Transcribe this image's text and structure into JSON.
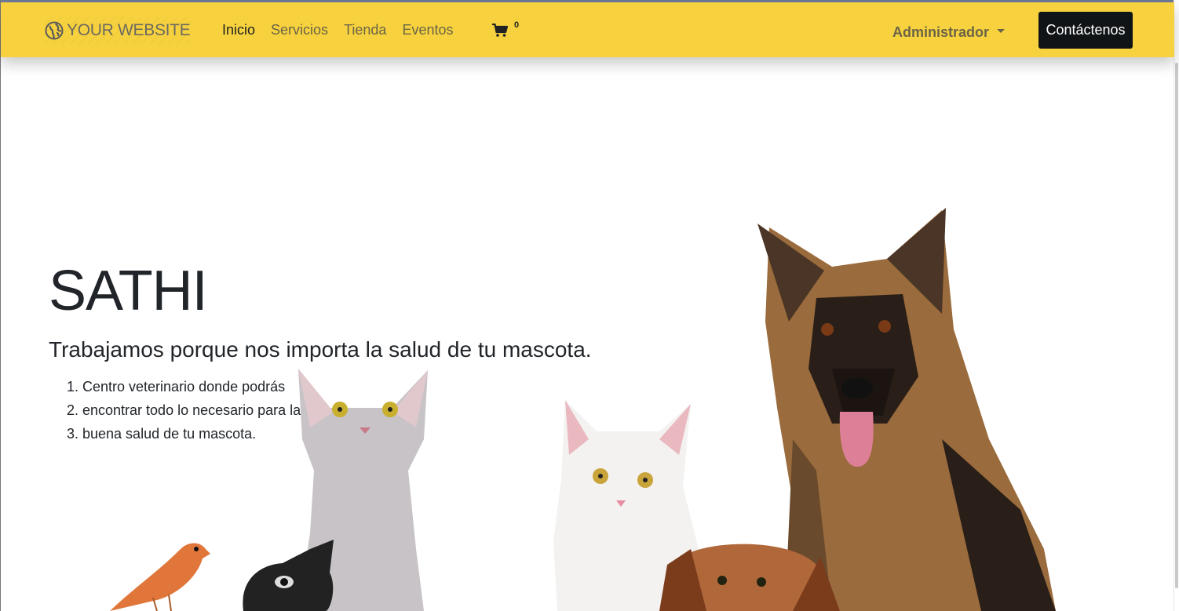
{
  "navbar": {
    "brand": "YOUR WEBSITE",
    "links": [
      "Inicio",
      "Servicios",
      "Tienda",
      "Eventos"
    ],
    "active_link": "Inicio",
    "cart_count": "0",
    "admin_label": "Administrador",
    "contact_label": "Contáctenos",
    "bg_color": "#f7d23e"
  },
  "hero": {
    "title": "SATHI",
    "subtitle": "Trabajamos porque nos importa la salud de tu mascota.",
    "list": [
      "Centro veterinario donde podrás",
      "encontrar todo lo necesario para la",
      "buena salud de tu mascota."
    ]
  },
  "icons": {
    "brand": "globe-icon",
    "cart": "shopping-cart-icon",
    "admin": "caret-down-icon"
  }
}
